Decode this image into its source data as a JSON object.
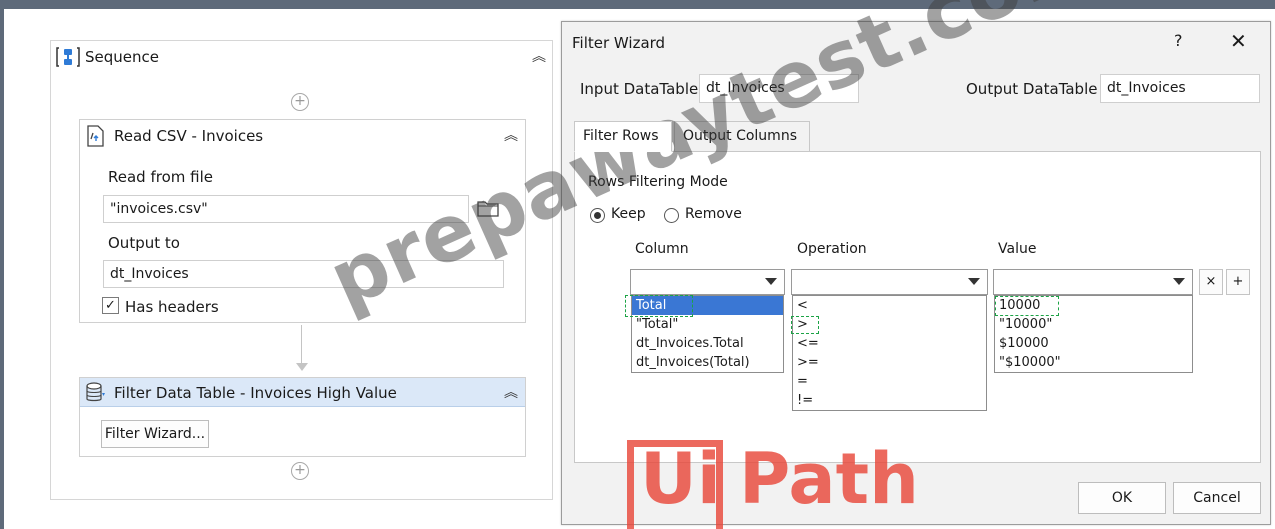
{
  "sequence": {
    "title": "Sequence",
    "read_csv": {
      "title": "Read CSV - Invoices",
      "read_from_file_label": "Read from file",
      "read_from_file_value": "\"invoices.csv\"",
      "output_to_label": "Output to",
      "output_to_value": "dt_Invoices",
      "has_headers_label": "Has headers",
      "has_headers_checked": "✓"
    },
    "filter_data_table": {
      "title": "Filter Data Table - Invoices High Value",
      "button_label": "Filter Wizard..."
    },
    "add_symbol": "+"
  },
  "filter_wizard": {
    "title": "Filter Wizard",
    "help": "?",
    "close": "✕",
    "input_datatable_label": "Input DataTable",
    "input_datatable_value": "dt_Invoices",
    "output_datatable_label": "Output DataTable",
    "output_datatable_value": "dt_Invoices",
    "tabs": [
      {
        "label": "Filter Rows",
        "active": true
      },
      {
        "label": "Output Columns",
        "active": false
      }
    ],
    "rows_filtering_mode_label": "Rows Filtering Mode",
    "keep_label": "Keep",
    "remove_label": "Remove",
    "column_header": "Column",
    "operation_header": "Operation",
    "value_header": "Value",
    "remove_row_button": "×",
    "add_row_button": "+",
    "column_options": [
      "Total",
      "\"Total\"",
      "dt_Invoices.Total",
      "dt_Invoices(Total)"
    ],
    "operation_options": [
      "<",
      ">",
      "<=",
      ">=",
      "=",
      "!="
    ],
    "value_options": [
      "10000",
      "\"10000\"",
      "$10000",
      "\"$10000\""
    ],
    "ok_label": "OK",
    "cancel_label": "Cancel"
  },
  "watermark": "prepawaytest.com",
  "logo": {
    "ui": "Ui",
    "path": "Path"
  },
  "colors": {
    "highlight": "#3a77d4",
    "dashed_marker": "#1ca346",
    "logo": "#e8483a",
    "activity_selected": "#dbe8f8"
  }
}
